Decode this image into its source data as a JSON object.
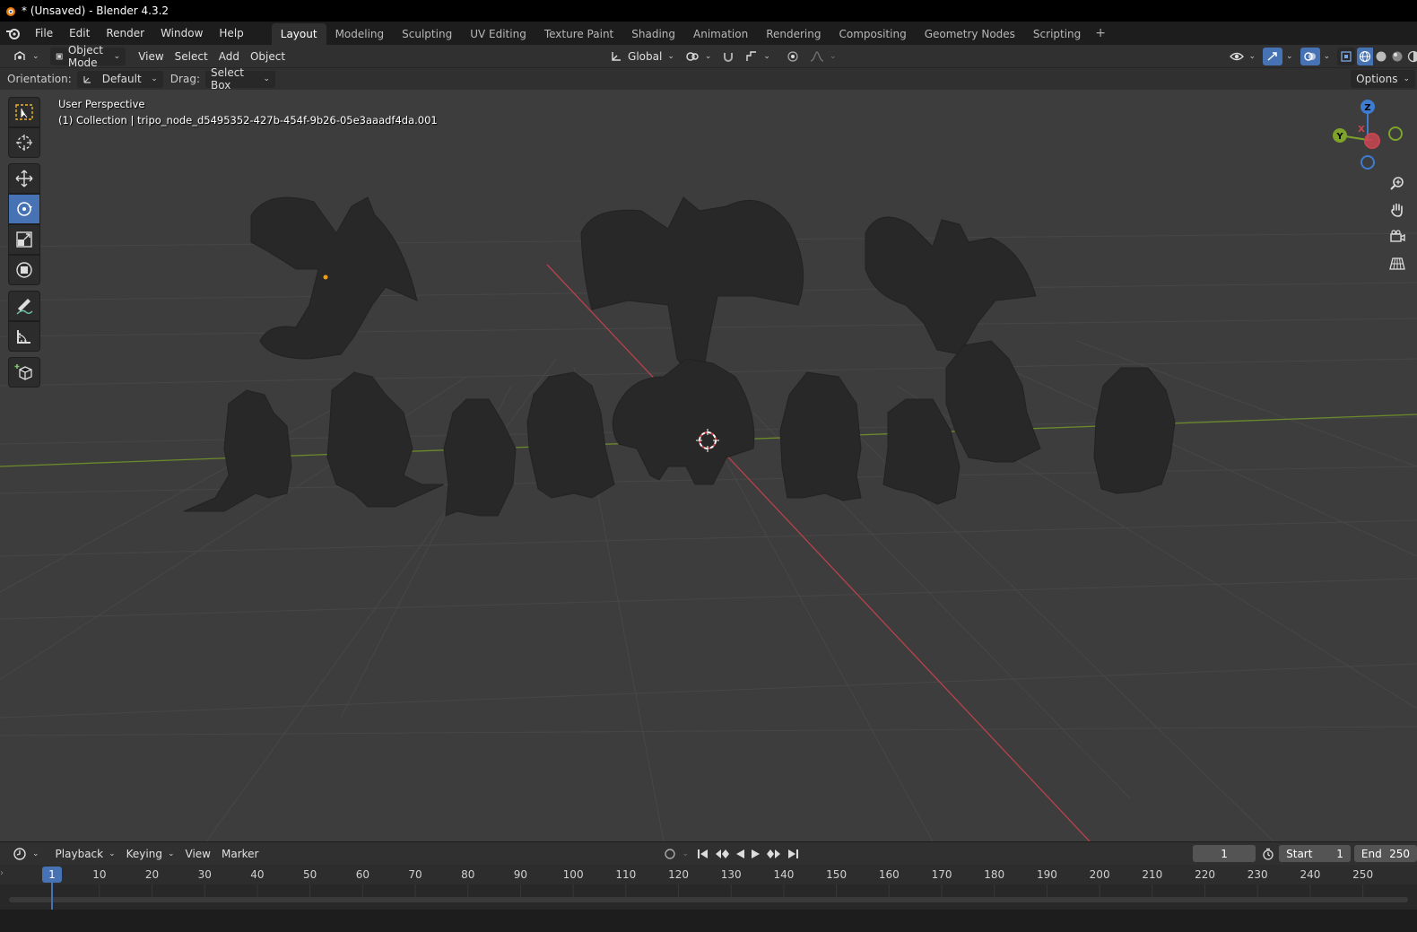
{
  "window": {
    "title": "* (Unsaved) - Blender 4.3.2"
  },
  "menu": {
    "items": [
      "File",
      "Edit",
      "Render",
      "Window",
      "Help"
    ]
  },
  "workspaces": {
    "tabs": [
      "Layout",
      "Modeling",
      "Sculpting",
      "UV Editing",
      "Texture Paint",
      "Shading",
      "Animation",
      "Rendering",
      "Compositing",
      "Geometry Nodes",
      "Scripting"
    ],
    "active": "Layout"
  },
  "header3d": {
    "mode": "Object Mode",
    "menus": [
      "View",
      "Select",
      "Add",
      "Object"
    ],
    "transform_orientation": "Global"
  },
  "tool_settings": {
    "orientation_label": "Orientation:",
    "orientation_value": "Default",
    "drag_label": "Drag:",
    "drag_value": "Select Box",
    "options": "Options"
  },
  "viewport": {
    "perspective": "User Perspective",
    "collection_info": "(1) Collection | tripo_node_d5495352-427b-454f-9b26-05e3aaadf4da.001",
    "gizmo_axes": [
      "Z",
      "Y",
      "X"
    ]
  },
  "timeline": {
    "menus": [
      "Playback",
      "Keying",
      "View",
      "Marker"
    ],
    "current_frame": "1",
    "start_label": "Start",
    "start_value": "1",
    "end_label": "End",
    "end_value": "250",
    "ticks": [
      "10",
      "20",
      "30",
      "40",
      "50",
      "60",
      "70",
      "80",
      "90",
      "100",
      "110",
      "120",
      "130",
      "140",
      "150",
      "160",
      "170",
      "180",
      "190",
      "200",
      "210",
      "220",
      "230",
      "240",
      "250"
    ],
    "marker": "1"
  },
  "colors": {
    "accent": "#4772b3",
    "x_axis": "#c94651",
    "y_axis": "#7ea32a",
    "z_axis": "#3d7cd1",
    "viewport_bg": "#3d3d3d"
  }
}
